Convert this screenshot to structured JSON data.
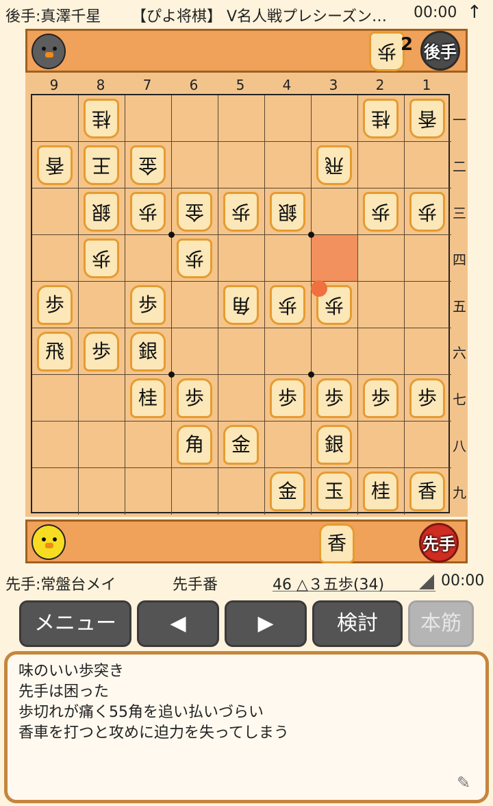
{
  "header": {
    "gote_player": "後手:真澤千星",
    "title": "【ぴよ将棋】 V名人戦プレシーズン…",
    "gote_time": "00:00",
    "arrow_icon": "up-arrow-icon"
  },
  "gote_stand": {
    "badge": "後手",
    "pieces": [
      {
        "kanji": "歩",
        "count": "2"
      }
    ]
  },
  "sente_stand": {
    "badge": "先手",
    "pieces": [
      {
        "kanji": "香"
      }
    ]
  },
  "board": {
    "file_labels": [
      "9",
      "8",
      "7",
      "6",
      "5",
      "4",
      "3",
      "2",
      "1"
    ],
    "rank_labels": [
      "一",
      "二",
      "三",
      "四",
      "五",
      "六",
      "七",
      "八",
      "九"
    ],
    "pieces": [
      {
        "file": 8,
        "rank": 1,
        "kanji": "桂",
        "side": "gote"
      },
      {
        "file": 2,
        "rank": 1,
        "kanji": "桂",
        "side": "gote"
      },
      {
        "file": 1,
        "rank": 1,
        "kanji": "香",
        "side": "gote"
      },
      {
        "file": 9,
        "rank": 2,
        "kanji": "香",
        "side": "gote"
      },
      {
        "file": 8,
        "rank": 2,
        "kanji": "王",
        "side": "gote"
      },
      {
        "file": 7,
        "rank": 2,
        "kanji": "金",
        "side": "gote"
      },
      {
        "file": 3,
        "rank": 2,
        "kanji": "飛",
        "side": "gote"
      },
      {
        "file": 8,
        "rank": 3,
        "kanji": "銀",
        "side": "gote"
      },
      {
        "file": 7,
        "rank": 3,
        "kanji": "歩",
        "side": "gote"
      },
      {
        "file": 6,
        "rank": 3,
        "kanji": "金",
        "side": "gote"
      },
      {
        "file": 5,
        "rank": 3,
        "kanji": "歩",
        "side": "gote"
      },
      {
        "file": 4,
        "rank": 3,
        "kanji": "銀",
        "side": "gote"
      },
      {
        "file": 2,
        "rank": 3,
        "kanji": "歩",
        "side": "gote"
      },
      {
        "file": 1,
        "rank": 3,
        "kanji": "歩",
        "side": "gote"
      },
      {
        "file": 8,
        "rank": 4,
        "kanji": "歩",
        "side": "gote"
      },
      {
        "file": 6,
        "rank": 4,
        "kanji": "歩",
        "side": "gote"
      },
      {
        "file": 9,
        "rank": 5,
        "kanji": "歩",
        "side": "sente"
      },
      {
        "file": 7,
        "rank": 5,
        "kanji": "歩",
        "side": "sente"
      },
      {
        "file": 5,
        "rank": 5,
        "kanji": "角",
        "side": "gote"
      },
      {
        "file": 4,
        "rank": 5,
        "kanji": "歩",
        "side": "gote"
      },
      {
        "file": 3,
        "rank": 5,
        "kanji": "歩",
        "side": "gote"
      },
      {
        "file": 9,
        "rank": 6,
        "kanji": "飛",
        "side": "sente"
      },
      {
        "file": 8,
        "rank": 6,
        "kanji": "歩",
        "side": "sente"
      },
      {
        "file": 7,
        "rank": 6,
        "kanji": "銀",
        "side": "sente"
      },
      {
        "file": 7,
        "rank": 7,
        "kanji": "桂",
        "side": "sente"
      },
      {
        "file": 6,
        "rank": 7,
        "kanji": "歩",
        "side": "sente"
      },
      {
        "file": 4,
        "rank": 7,
        "kanji": "歩",
        "side": "sente"
      },
      {
        "file": 3,
        "rank": 7,
        "kanji": "歩",
        "side": "sente"
      },
      {
        "file": 2,
        "rank": 7,
        "kanji": "歩",
        "side": "sente"
      },
      {
        "file": 1,
        "rank": 7,
        "kanji": "歩",
        "side": "sente"
      },
      {
        "file": 6,
        "rank": 8,
        "kanji": "角",
        "side": "sente"
      },
      {
        "file": 5,
        "rank": 8,
        "kanji": "金",
        "side": "sente"
      },
      {
        "file": 3,
        "rank": 8,
        "kanji": "銀",
        "side": "sente"
      },
      {
        "file": 4,
        "rank": 9,
        "kanji": "金",
        "side": "sente"
      },
      {
        "file": 3,
        "rank": 9,
        "kanji": "玉",
        "side": "sente"
      },
      {
        "file": 2,
        "rank": 9,
        "kanji": "桂",
        "side": "sente"
      },
      {
        "file": 1,
        "rank": 9,
        "kanji": "香",
        "side": "sente"
      }
    ],
    "last_move_from": {
      "file": 3,
      "rank": 4
    },
    "last_move_to": {
      "file": 3,
      "rank": 5
    },
    "highlight_color": "#f07040"
  },
  "footer": {
    "sente_player": "先手:常盤台メイ",
    "turn": "先手番",
    "move": "46 △３五歩(34)",
    "sente_time": "00:00"
  },
  "buttons": {
    "menu": "メニュー",
    "prev": "◀",
    "next": "▶",
    "analyze": "検討",
    "mainline": "本筋"
  },
  "comment": {
    "lines": [
      "味のいい歩突き",
      "先手は困った",
      "歩切れが痛く55角を追い払いづらい",
      "香車を打つと攻めに迫力を失ってしまう"
    ]
  }
}
